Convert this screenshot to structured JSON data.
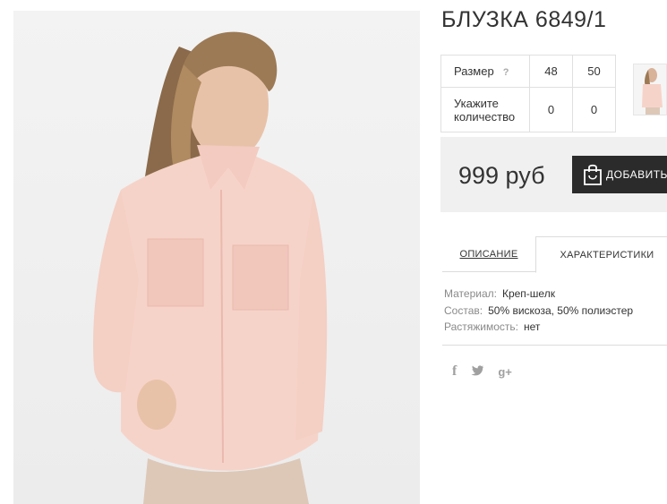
{
  "product": {
    "title": "БЛУЗКА 6849/1"
  },
  "sizes": {
    "size_label": "Размер",
    "help_icon": "?",
    "values": [
      "48",
      "50"
    ],
    "qty_label": "Укажите количество",
    "quantities": [
      "0",
      "0"
    ]
  },
  "purchase": {
    "price": "999 руб",
    "add_label": "ДОБАВИТЬ",
    "icon": "shopping-bag-icon"
  },
  "tabs": {
    "description": "ОПИСАНИЕ",
    "characteristics": "ХАРАКТЕРИСТИКИ"
  },
  "characteristics": [
    {
      "key": "Материал:",
      "value": "Креп-шелк"
    },
    {
      "key": "Состав:",
      "value": "50% вискоза, 50% полиэстер"
    },
    {
      "key": "Растяжимость:",
      "value": "нет"
    }
  ],
  "social": {
    "facebook": "f",
    "twitter": "t",
    "googleplus": "g+"
  },
  "colors": {
    "button_bg": "#2b2b2b",
    "price_bg": "#f0f0f0",
    "blouse": "#f6d3c9"
  }
}
